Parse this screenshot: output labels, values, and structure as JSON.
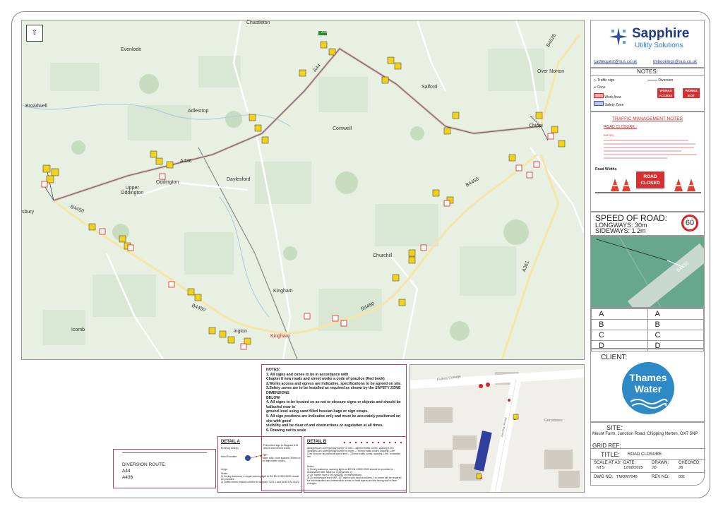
{
  "map": {
    "place_labels": {
      "chastleton": "Chastleton",
      "evenlode": "Evenlode",
      "broadwell": "Broadwell",
      "adlestrop": "Adlestrop",
      "cornwell": "Cornwell",
      "salford": "Salford",
      "over_norton": "Over Norton",
      "chipping": "Chippi",
      "upper_oddington": "Upper\nOddington",
      "oddington": "Oddington",
      "daylesford": "Daylesford",
      "churchill": "Churchill",
      "kingham_village": "Kingham",
      "kingham_station": "Kingham",
      "icomb": "Icomb",
      "bury": "sbury",
      "ington": "ington"
    },
    "road_labels": {
      "a44_shield": "A44",
      "a44": "A44",
      "a436": "A436",
      "b4450_west": "B4450",
      "b4450_east": "B4450",
      "b4450_south": "B4450",
      "b4450_mid": "B4450",
      "a361": "A361",
      "b4026": "B4026"
    }
  },
  "logo": {
    "company": "Sapphire",
    "subtitle": "Utility Solutions"
  },
  "contacts": {
    "email1": "cadrequest@sus.co.uk",
    "email2": "tmbookings@sus.co.uk"
  },
  "legend": {
    "title": "NOTES:",
    "traffic_sign": "Traffic sign",
    "diversion": "Diversion",
    "cone": "Cone",
    "work_area": "Work Area",
    "safety_zone": "Safety Zone",
    "works_access": "WORKS ACCESS",
    "works_exit": "WORKS EXIT"
  },
  "tm_notes": {
    "title": "TRAFFIC MANAGEMENT NOTES",
    "subtitle": "ROAD CLOSURE :",
    "notes_label": "NOTES:",
    "road_widths": "Road Widths",
    "road_closed": "ROAD\nCLOSED"
  },
  "speed": {
    "label": "SPEED OF ROAD:",
    "longways": "LONGWAYS:  30m",
    "sideways": "SIDEWAYS:  1.2m",
    "limit": "60"
  },
  "inset_road_label": "B4450",
  "ref_table": [
    [
      "A",
      "A"
    ],
    [
      "B",
      "B"
    ],
    [
      "C",
      "C"
    ],
    [
      "D",
      "D"
    ]
  ],
  "client": {
    "label": "CLIENT:",
    "name_line1": "Thames",
    "name_line2": "Water"
  },
  "site": {
    "label": "SITE:",
    "address": "Mount Farm, Junction Road, Chipping Norton, OX7 5NP",
    "grid_ref": "GRID REF:",
    "title_label": "TITLE:",
    "title_value": "ROAD CLOSURE",
    "scale_label": "SCALE AT A3:",
    "scale_value": "NTS",
    "date_label": "DATE:",
    "date_value": "12/08/2025",
    "drawn_label": "DRAWN:",
    "drawn_value": "JD",
    "checked_label": "CHECKED:",
    "checked_value": "JB",
    "dwg_label": "DWG NO:",
    "dwg_value": "TMGW7049",
    "rev_label": "REV NO:",
    "rev_value": "001"
  },
  "diversion": {
    "title": "DIVERSION ROUTE:",
    "route1": "A44",
    "route2": "A436"
  },
  "detail_a": {
    "title": "DETAIL A",
    "running_lane": "Running lane(s)",
    "sign_note": "Prescribed sign to Diagram 610 above and behind cones",
    "hard_shoulder": "Hard Shoulder",
    "taper_note": "Taper only: cone spaced 750mm or 1m tight traffic cones",
    "verge": "Verge",
    "notes": "Notes\n1) During darkness, a single warning light to BS EN 12352:2000 should be provided.\n2) Traffic cones should conform to diagram 7101.1 and to BS EN 13422."
  },
  "detail_b": {
    "title": "DETAIL B",
    "text": "Straight/Curb cone/greylay 40mph or less – 450mm traffic cones, spacing 1.5m\nStraight/Curb cone/greylay 50mph or more – 750mm traffic cones, spacing 1.5m\nCost cost per lay national speed limit – 750mm traffic cones, spacing 1.5m, extraction 9m",
    "notes": "Notes\n1) During darkness, warning lights to BS EN 12352:2000 should be provided in accordance with Table A1.3 (Appendix 1).\n2) 45° tapers have 1.5m spacing, on intersections.\n3) On motorways and HWS, 45° tapers with hard shoulders, 1m cones will be required for both standard and intersection works for lead tapers and the facing wall of lane changes."
  },
  "general_notes": {
    "title": "NOTES:",
    "items": [
      "1. All signs and cones to be in accordance with",
      "Chapter 8 new roads and street works a code of practice (Red book)",
      "2.Works access and egress are indicative, specifications to be agreed on site.",
      "3.Safety zones are to be installed as required as shown by the SAFETY ZONE DIMENSIONS",
      "BELOW",
      "4. All signs to be located so as not to obscure signs or objects and should be ballasted near to",
      "ground level using sand filled hessian bags or sign straps.",
      "5. All sign positions are indicative only and must be accurately positioned on site with good",
      "visibility and be clear of and obstructions or vegetation at all times.",
      "6. Drawing not to scale"
    ]
  },
  "site_inset": {
    "farm_cottage": "Fullers Cottage",
    "greystones": "Greystones",
    "road_name": "Junction Road"
  }
}
